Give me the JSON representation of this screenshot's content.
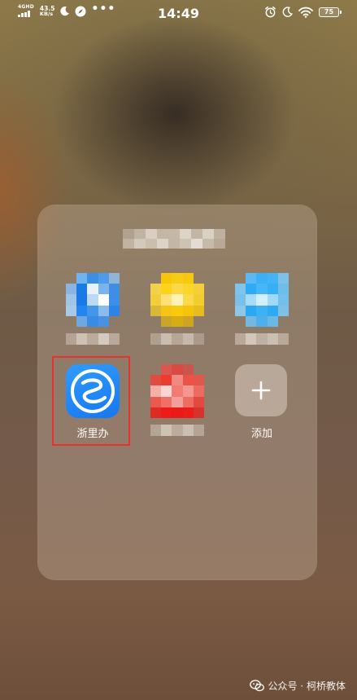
{
  "status_bar": {
    "network_label": "4GHD",
    "speed_value": "43.5",
    "speed_unit": "KB/s",
    "time": "14:49",
    "battery": "75",
    "icons": [
      "signal-icon",
      "moon-icon",
      "compass-icon",
      "more-icon",
      "alarm-icon",
      "moon-icon",
      "wifi-icon",
      "battery-icon"
    ]
  },
  "folder": {
    "apps": [
      {
        "name": "blurred-app-1",
        "label": ""
      },
      {
        "name": "blurred-app-2",
        "label": ""
      },
      {
        "name": "blurred-app-3",
        "label": ""
      },
      {
        "name": "zheliban",
        "label": "浙里办"
      },
      {
        "name": "blurred-app-5",
        "label": ""
      },
      {
        "name": "add",
        "label": "添加",
        "icon": "plus-icon"
      }
    ]
  },
  "watermark": {
    "text": "公众号 · 柯桥教体",
    "icon": "wechat-icon"
  },
  "colors": {
    "highlight": "#e8322f",
    "zheliban_blue": "#1677f2"
  }
}
